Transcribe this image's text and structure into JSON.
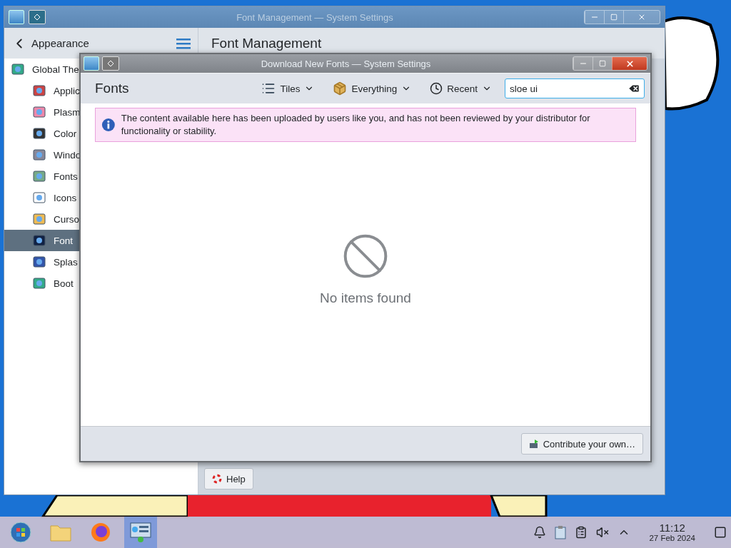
{
  "back_window": {
    "title": "Font Management — System Settings",
    "sidebar": {
      "header": "Appearance",
      "items": [
        {
          "label": "Global The",
          "selected": false,
          "children": [
            {
              "label": "Applic",
              "selected": false
            },
            {
              "label": "Plasm",
              "selected": false
            },
            {
              "label": "Color",
              "selected": false
            },
            {
              "label": "Windo",
              "selected": false
            },
            {
              "label": "Fonts",
              "selected": false
            },
            {
              "label": "Icons",
              "selected": false
            },
            {
              "label": "Curso",
              "selected": false
            },
            {
              "label": "Font",
              "selected": true
            },
            {
              "label": "Splas",
              "selected": false
            },
            {
              "label": "Boot",
              "selected": false
            }
          ]
        }
      ]
    },
    "page_title": "Font Management",
    "help_button": "Help"
  },
  "dialog": {
    "title": "Download New Fonts — System Settings",
    "heading": "Fonts",
    "view_menu": "Tiles",
    "category_menu": "Everything",
    "sort_menu": "Recent",
    "search": {
      "value": "sloe ui"
    },
    "notice": "The content available here has been uploaded by users like you, and has not been reviewed by your distributor for functionality or stability.",
    "empty_message": "No items found",
    "contribute_button": "Contribute your own…"
  },
  "taskbar": {
    "apps": [
      {
        "kind": "start",
        "selected": false
      },
      {
        "kind": "files",
        "selected": false
      },
      {
        "kind": "browser",
        "selected": false
      },
      {
        "kind": "settings",
        "selected": true
      }
    ],
    "clock": {
      "time": "11:12",
      "date": "27 Feb 2024"
    }
  }
}
